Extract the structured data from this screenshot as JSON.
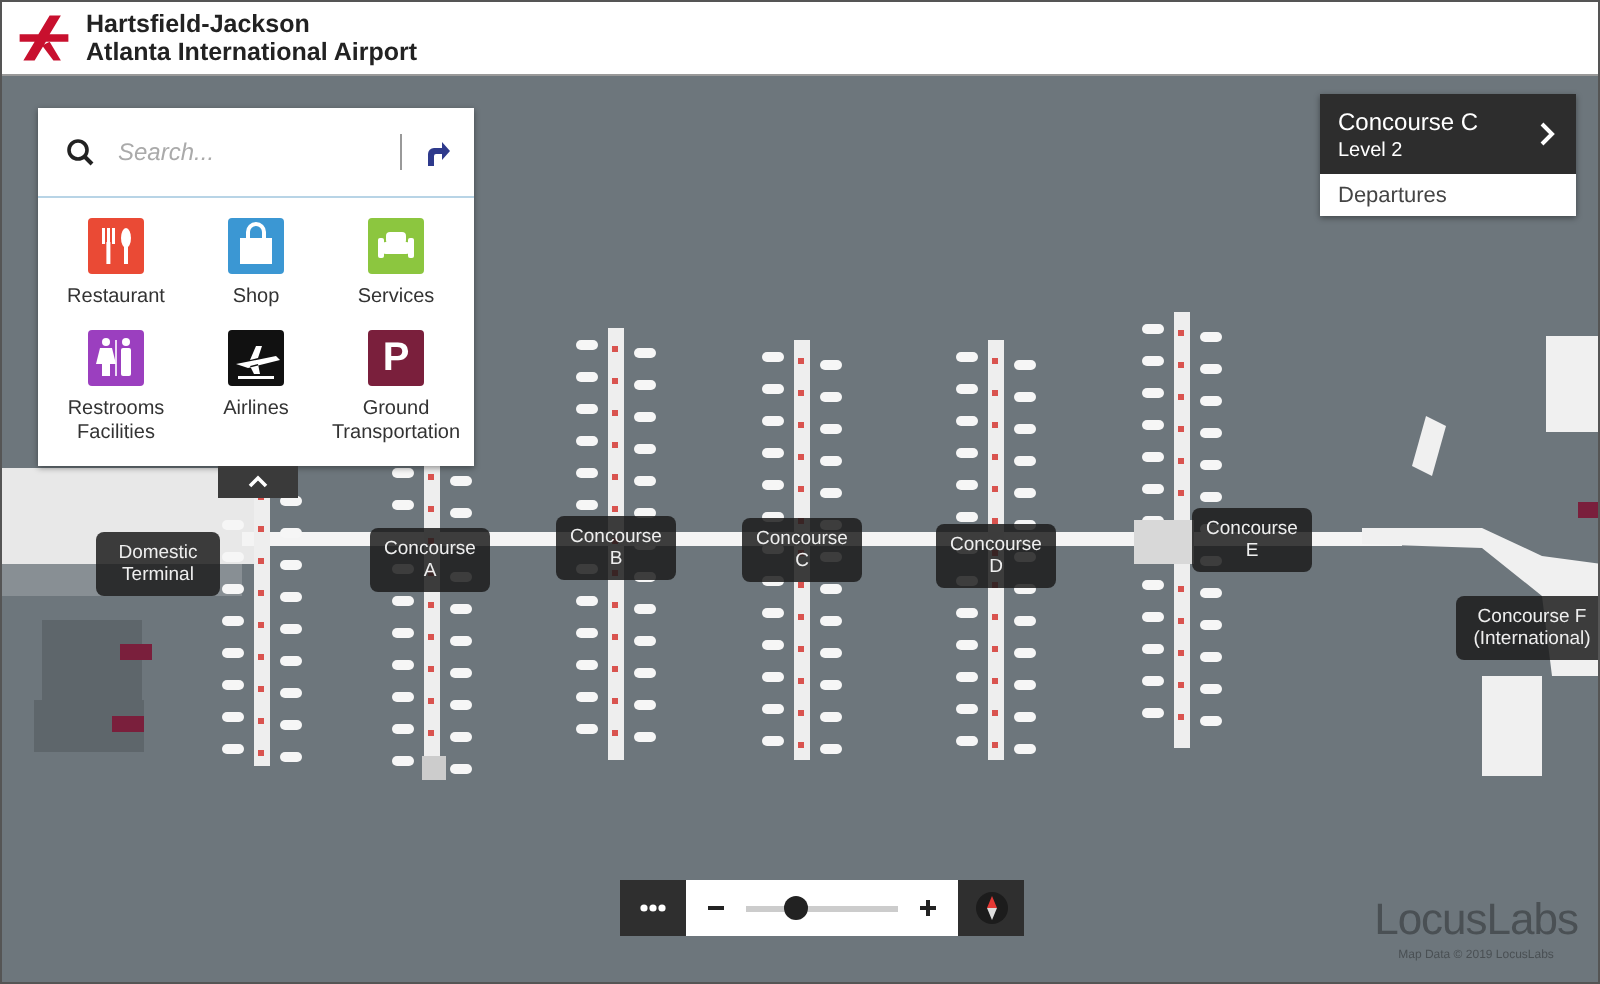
{
  "header": {
    "title_line_1": "Hartsfield-Jackson",
    "title_line_2": "Atlanta International Airport"
  },
  "search": {
    "placeholder": "Search..."
  },
  "categories": [
    {
      "label": "Restaurant",
      "kind": "restaurant",
      "color": "#ea4a35"
    },
    {
      "label": "Shop",
      "kind": "shop",
      "color": "#3b97d3"
    },
    {
      "label": "Services",
      "kind": "services",
      "color": "#8cc63f"
    },
    {
      "label": "Restrooms Facilities",
      "kind": "restrooms",
      "color": "#9b3fbf"
    },
    {
      "label": "Airlines",
      "kind": "airlines",
      "color": "#111111"
    },
    {
      "label": "Ground Transportation",
      "kind": "parking",
      "color": "#7a1f3c",
      "glyph": "P"
    }
  ],
  "location_card": {
    "title": "Concourse C",
    "subtitle": "Level 2",
    "action": "Departures"
  },
  "map_labels": [
    {
      "label": "Domestic Terminal"
    },
    {
      "label": "Concourse A"
    },
    {
      "label": "Concourse B"
    },
    {
      "label": "Concourse C"
    },
    {
      "label": "Concourse D"
    },
    {
      "label": "Concourse E"
    },
    {
      "label": "Concourse F (International)"
    }
  ],
  "zoom": {
    "level": 0.3
  },
  "branding": {
    "logo": "LocusLabs",
    "copyright": "Map Data © 2019 LocusLabs"
  }
}
